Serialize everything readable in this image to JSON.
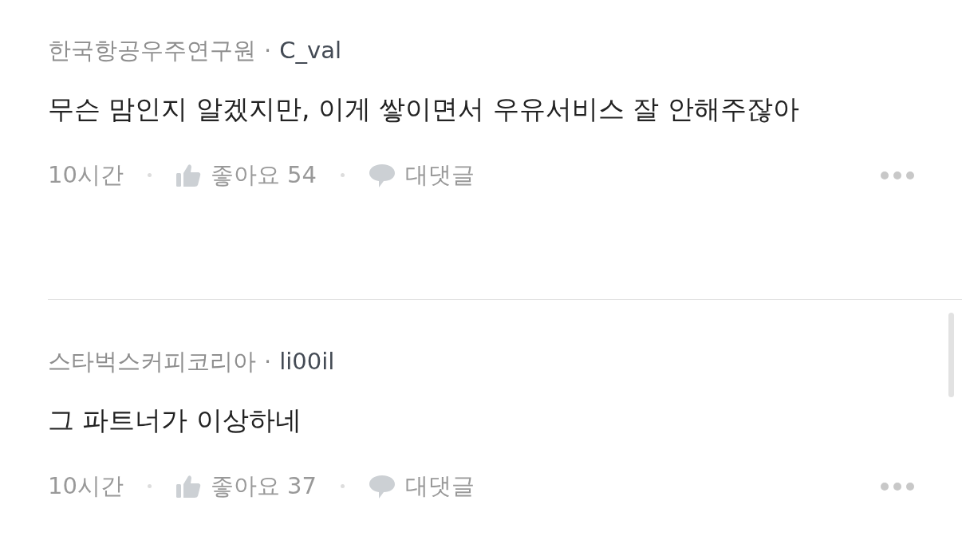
{
  "comments": [
    {
      "organization": "한국항공우주연구원",
      "separator": "·",
      "username": "C_val",
      "body": "무슨 맘인지 알겠지만, 이게 쌓이면서 우유서비스 잘 안해주잖아",
      "time": "10시간",
      "like_label": "좋아요 54",
      "reply_label": "대댓글"
    },
    {
      "organization": "스타벅스커피코리아",
      "separator": "·",
      "username": "li00il",
      "body": "그 파트너가 이상하네",
      "time": "10시간",
      "like_label": "좋아요 37",
      "reply_label": "대댓글"
    }
  ]
}
